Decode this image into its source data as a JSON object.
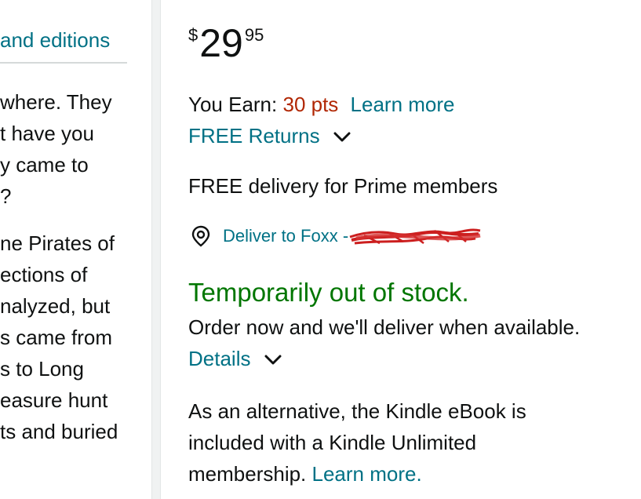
{
  "left": {
    "editions_link": "and editions",
    "para1_lines": [
      "where. They",
      "t have you",
      "y came to",
      "?"
    ],
    "para2_lines": [
      "ne Pirates of",
      "ections of",
      "nalyzed, but",
      "s came from",
      "s to Long",
      "easure hunt",
      "ts and buried"
    ]
  },
  "price": {
    "symbol": "$",
    "whole": "29",
    "fraction": "95"
  },
  "earn": {
    "label": "You Earn:",
    "points": "30 pts",
    "learn_more": "Learn more"
  },
  "returns": {
    "label": "FREE Returns",
    "icon": "chevron-down-icon"
  },
  "delivery": {
    "text": "FREE delivery for Prime members"
  },
  "deliver_to": {
    "icon": "location-pin-icon",
    "label": "Deliver to Foxx - "
  },
  "stock": {
    "status": "Temporarily out of stock.",
    "order_note": "Order now and we'll deliver when available.",
    "details_label": "Details",
    "details_icon": "chevron-down-icon"
  },
  "alternative": {
    "line1": "As an alternative, the Kindle eBook is",
    "line2": "included with a Kindle Unlimited",
    "line3_prefix": "membership.",
    "learn_more": "Learn more."
  },
  "colors": {
    "link": "#007185",
    "price_points": "#b12704",
    "in_stock_green": "#007600",
    "text": "#0f1111",
    "redaction": "#cc1f1f"
  }
}
